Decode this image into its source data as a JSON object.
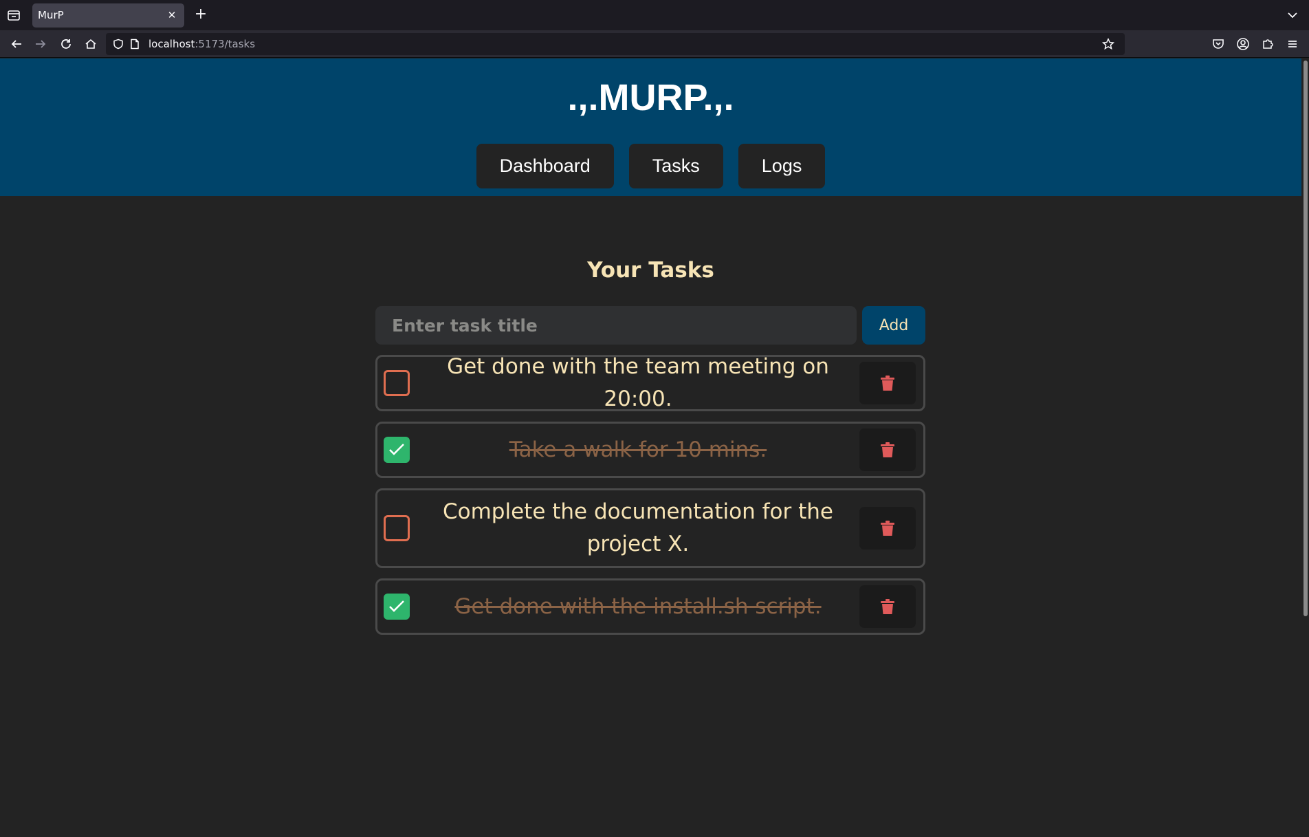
{
  "browser": {
    "tab_title": "MurP",
    "url_host": "localhost",
    "url_path": ":5173/tasks"
  },
  "app": {
    "title": ".,.MURP.,.",
    "nav": {
      "dashboard": "Dashboard",
      "tasks": "Tasks",
      "logs": "Logs"
    }
  },
  "tasks_page": {
    "heading": "Your Tasks",
    "input_placeholder": "Enter task title",
    "add_label": "Add",
    "items": [
      {
        "title": "Get done with the team meeting on 20:00.",
        "completed": false
      },
      {
        "title": "Take a walk for 10 mins.",
        "completed": true
      },
      {
        "title": "Complete the documentation for the project X.",
        "completed": false
      },
      {
        "title": "Get done with the install.sh script.",
        "completed": true
      }
    ]
  },
  "colors": {
    "header_bg": "#00446a",
    "page_bg": "#232323",
    "text_cream": "#f7e4b5",
    "check_green": "#2eb56c",
    "unchecked_border": "#e06e50",
    "trash_red": "#e05a5a",
    "done_text": "#8b6346"
  },
  "icons": {
    "tab_list": "tab-list-icon",
    "close": "close-icon",
    "new_tab": "plus-icon",
    "back": "back-arrow-icon",
    "forward": "forward-arrow-icon",
    "reload": "reload-icon",
    "home": "home-icon",
    "shield": "shield-icon",
    "page": "page-icon",
    "bookmark": "star-icon",
    "pocket": "pocket-icon",
    "account": "account-icon",
    "extensions": "puzzle-icon",
    "menu": "hamburger-icon",
    "check": "checkmark-icon",
    "trash": "trash-icon"
  }
}
